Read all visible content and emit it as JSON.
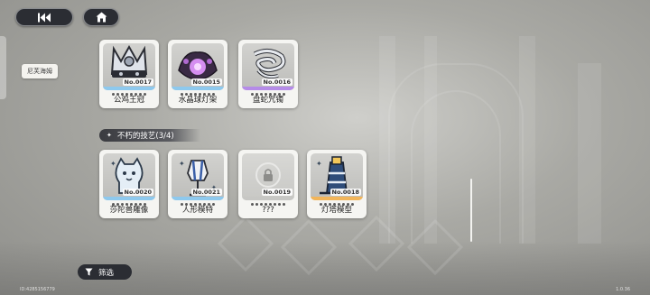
{
  "nav": {
    "back_icon": "back-arrow-icon",
    "home_icon": "home-icon"
  },
  "sidebar": {
    "active_tab": "尼芙海姆"
  },
  "collections": {
    "top_items": [
      {
        "number": "No.0017",
        "name": "公鸡王冠",
        "rarity_color": "#8ec9ee"
      },
      {
        "number": "No.0015",
        "name": "水晶球灯架",
        "rarity_color": "#8ec9ee"
      },
      {
        "number": "No.0016",
        "name": "盘蛇咒镯",
        "rarity_color": "#b58be8"
      }
    ],
    "section": {
      "title": "不朽的技艺(3/4)",
      "items": [
        {
          "number": "No.0020",
          "name": "莎陀兽雕像",
          "rarity_color": "#8ec9ee",
          "locked": false
        },
        {
          "number": "No.0021",
          "name": "人形模特",
          "rarity_color": "#8ec9ee",
          "locked": false
        },
        {
          "number": "No.0019",
          "name": "???",
          "rarity_color": "#c7c7c4",
          "locked": true
        },
        {
          "number": "No.0018",
          "name": "灯塔模型",
          "rarity_color": "#f2b55a",
          "locked": false
        }
      ]
    }
  },
  "filter": {
    "label": "筛选"
  },
  "footer": {
    "uid": "ID:4285156779",
    "version": "1.0.36"
  }
}
